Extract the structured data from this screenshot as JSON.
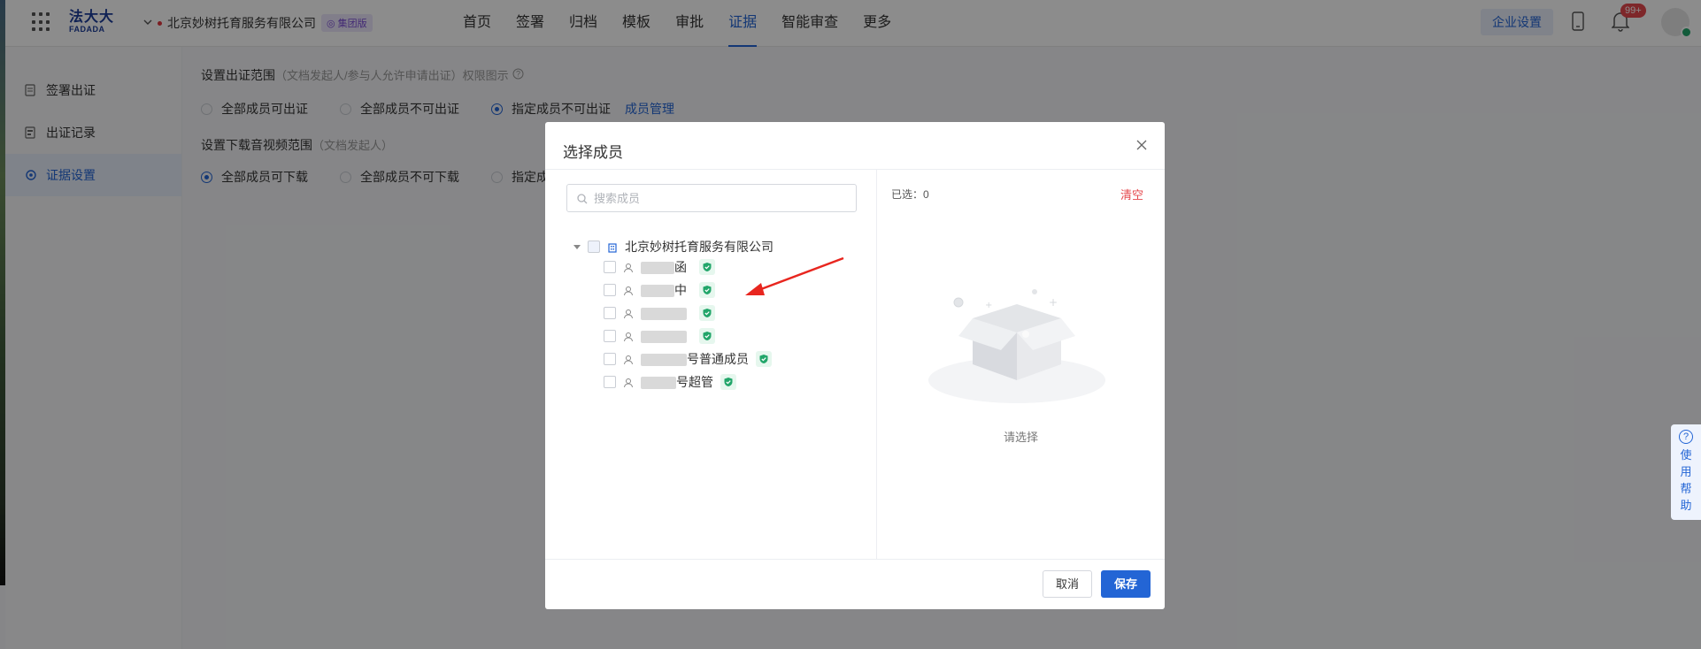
{
  "topbar": {
    "logo_cn": "法大大",
    "logo_en": "FADADA",
    "company": "北京妙树托育服务有限公司",
    "company_badge": "集团版",
    "nav": [
      "首页",
      "签署",
      "归档",
      "模板",
      "审批",
      "证据",
      "智能审查",
      "更多"
    ],
    "active_nav": "证据",
    "corp_settings": "企业设置",
    "notification_count": "99+"
  },
  "sidebar": {
    "items": [
      {
        "label": "签署出证",
        "icon": "document-icon"
      },
      {
        "label": "出证记录",
        "icon": "record-icon"
      },
      {
        "label": "证据设置",
        "icon": "gear-icon"
      }
    ],
    "active": "证据设置"
  },
  "content": {
    "section1": {
      "title": "设置出证范围",
      "hint": "（文档发起人/参与人允许申请出证）权限图示",
      "options": [
        "全部成员可出证",
        "全部成员不可出证",
        "指定成员不可出证"
      ],
      "selected_index": 2,
      "link": "成员管理"
    },
    "section2": {
      "title": "设置下载音视频范围",
      "hint": "（文档发起人）",
      "options": [
        "全部成员可下载",
        "全部成员不可下载",
        "指定成"
      ],
      "selected_index": 0
    }
  },
  "help_tab": {
    "chars": [
      "使",
      "用",
      "帮",
      "助"
    ]
  },
  "modal": {
    "title": "选择成员",
    "search_placeholder": "搜索成员",
    "org_name": "北京妙树托育服务有限公司",
    "members": [
      {
        "prefix": "",
        "suffix": "函"
      },
      {
        "prefix": "",
        "suffix": "中"
      },
      {
        "prefix": "",
        "suffix": ""
      },
      {
        "prefix": "",
        "suffix": ""
      },
      {
        "prefix": "",
        "suffix": "号普通成员"
      },
      {
        "prefix": "",
        "suffix": "号超管"
      }
    ],
    "selected_label": "已选：0",
    "clear_label": "清空",
    "empty_text": "请选择",
    "cancel_label": "取消",
    "save_label": "保存"
  },
  "colors": {
    "primary": "#2365d5",
    "danger": "#e5484d",
    "verified": "#22a66a"
  }
}
